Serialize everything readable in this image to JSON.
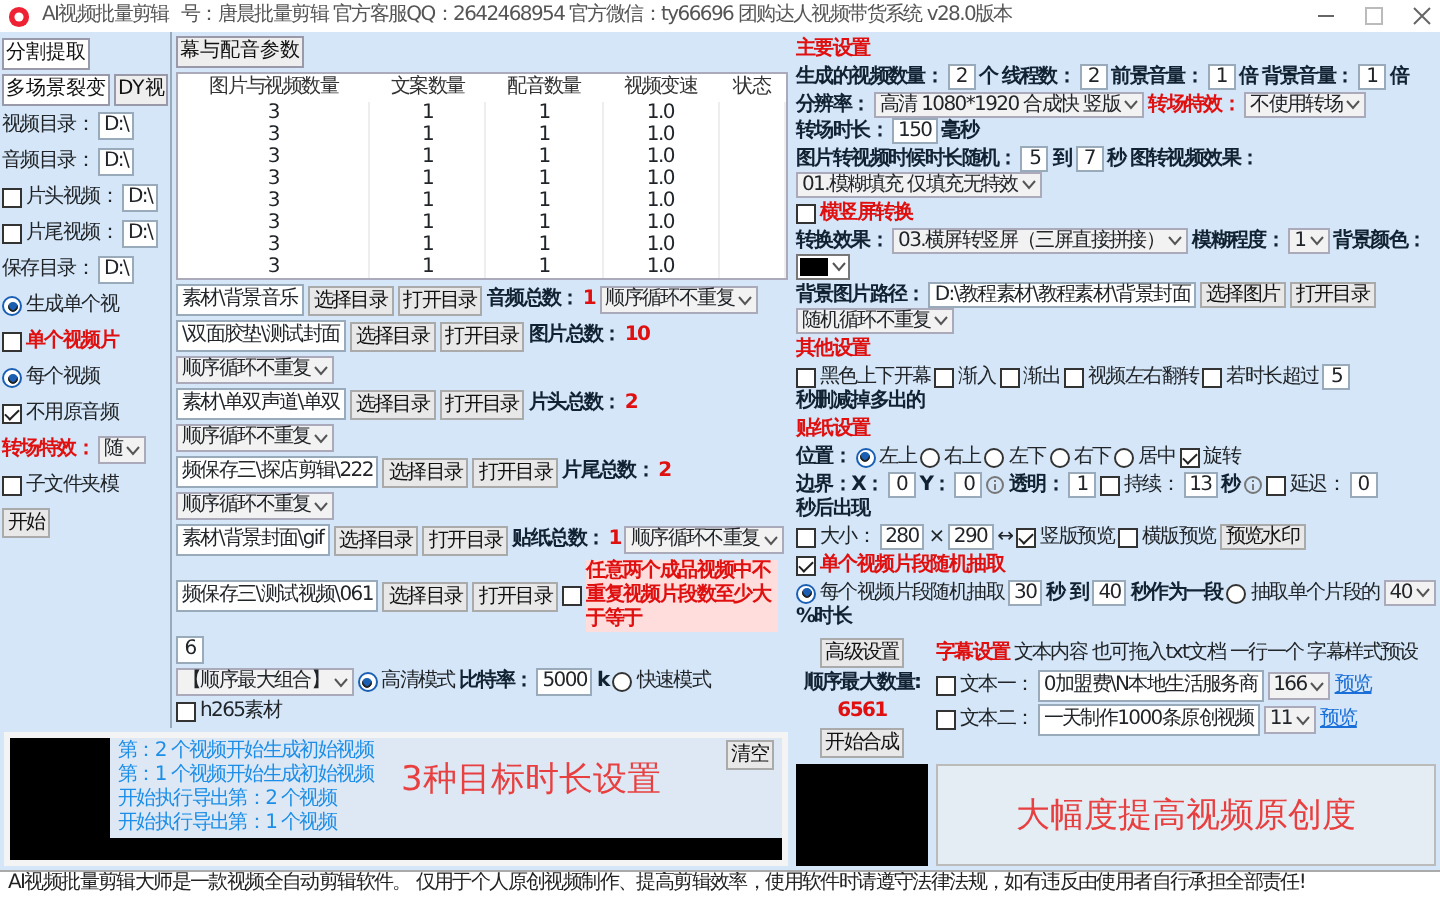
{
  "window": {
    "title": "AI视频批量剪辑",
    "subtitle": "号：唐晨批量剪辑  官方客服QQ：2642468954  官方微信：ty66696  团购达人视频带货系统  v28.0版本"
  },
  "left_panel": [
    {
      "items": [
        {
          "kind": "tab",
          "label": "分割提取",
          "selected": true
        },
        {
          "kind": "tab",
          "label": "幕与配音参数",
          "selected": false
        }
      ]
    },
    {
      "items": [
        {
          "kind": "tab",
          "label": "多场景裂变",
          "selected": true
        },
        {
          "kind": "tab",
          "label": "DY视",
          "selected": false
        }
      ]
    },
    {
      "items": [
        {
          "kind": "text",
          "text": "视频目录："
        },
        {
          "kind": "input",
          "value": "D:\\"
        }
      ]
    },
    {
      "items": [
        {
          "kind": "text",
          "text": "音频目录："
        },
        {
          "kind": "input",
          "value": "D:\\"
        }
      ]
    },
    {
      "items": [
        {
          "kind": "check",
          "label": "片头视频：",
          "checked": false
        },
        {
          "kind": "input",
          "value": "D:\\"
        }
      ]
    },
    {
      "items": [
        {
          "kind": "check",
          "label": "片尾视频：",
          "checked": false
        },
        {
          "kind": "input",
          "value": "D:\\"
        }
      ]
    },
    {
      "items": [
        {
          "kind": "text",
          "text": "保存目录："
        },
        {
          "kind": "input",
          "value": "D:\\"
        }
      ]
    },
    {
      "items": [
        {
          "kind": "radio",
          "label": "生成单个视",
          "selected": true
        }
      ]
    },
    {
      "items": [
        {
          "kind": "check",
          "label": "单个视频片",
          "checked": false,
          "alert": true
        }
      ]
    },
    {
      "items": [
        {
          "kind": "radio",
          "label": "每个视频",
          "selected": true
        }
      ]
    },
    {
      "items": [
        {
          "kind": "check",
          "label": "不用原音频",
          "checked": true
        }
      ]
    },
    {
      "items": [
        {
          "kind": "alert",
          "text": "转场特效："
        },
        {
          "kind": "select",
          "value": "随"
        }
      ]
    },
    {
      "items": [
        {
          "kind": "check",
          "label": "子文件夹模",
          "checked": false
        }
      ]
    },
    {
      "items": [
        {
          "kind": "button",
          "label": "开始"
        }
      ]
    }
  ],
  "table": {
    "columns": [
      "图片与视频数量",
      "文案数量",
      "配音数量",
      "视频变速",
      "状态"
    ],
    "rows": [
      [
        "3",
        "1",
        "1",
        "1.0"
      ],
      [
        "3",
        "1",
        "1",
        "1.0"
      ],
      [
        "3",
        "1",
        "1",
        "1.0"
      ],
      [
        "3",
        "1",
        "1",
        "1.0"
      ],
      [
        "3",
        "1",
        "1",
        "1.0"
      ],
      [
        "3",
        "1",
        "1",
        "1.0"
      ],
      [
        "3",
        "1",
        "1",
        "1.0"
      ],
      [
        "3",
        "1",
        "1",
        "1.0"
      ]
    ]
  },
  "middle_panel": [
    {
      "items": [
        {
          "kind": "path",
          "value": "素材\\背景音乐"
        },
        {
          "kind": "button",
          "label": "选择目录"
        },
        {
          "kind": "button",
          "label": "打开目录"
        },
        {
          "kind": "label",
          "text": "音频总数："
        },
        {
          "kind": "alert",
          "text": "1"
        },
        {
          "kind": "select",
          "value": "顺序循环不重复"
        }
      ]
    },
    {
      "items": [
        {
          "kind": "path",
          "value": "\\双面胶垫\\测试封面"
        },
        {
          "kind": "button",
          "label": "选择目录"
        },
        {
          "kind": "button",
          "label": "打开目录"
        },
        {
          "kind": "label",
          "text": "图片总数："
        },
        {
          "kind": "alert",
          "text": "10"
        },
        {
          "kind": "select",
          "value": "顺序循环不重复"
        }
      ]
    },
    {
      "items": [
        {
          "kind": "path",
          "value": "素材\\单双声道\\单双"
        },
        {
          "kind": "button",
          "label": "选择目录"
        },
        {
          "kind": "button",
          "label": "打开目录"
        },
        {
          "kind": "label",
          "text": "片头总数："
        },
        {
          "kind": "alert",
          "text": "2"
        },
        {
          "kind": "select",
          "value": "顺序循环不重复"
        }
      ]
    },
    {
      "items": [
        {
          "kind": "path",
          "value": "频保存三\\探店剪辑\\222"
        },
        {
          "kind": "button",
          "label": "选择目录"
        },
        {
          "kind": "button",
          "label": "打开目录"
        },
        {
          "kind": "label",
          "text": "片尾总数："
        },
        {
          "kind": "alert",
          "text": "2"
        },
        {
          "kind": "select",
          "value": "顺序循环不重复"
        }
      ]
    },
    {
      "items": [
        {
          "kind": "path",
          "value": "素材\\背景封面\\gif"
        },
        {
          "kind": "button",
          "label": "选择目录"
        },
        {
          "kind": "button",
          "label": "打开目录"
        },
        {
          "kind": "label",
          "text": "贴纸总数："
        },
        {
          "kind": "alert",
          "text": "1"
        },
        {
          "kind": "select",
          "value": "顺序循环不重复"
        }
      ]
    },
    {
      "items": [
        {
          "kind": "path",
          "value": "频保存三\\测试视频\\061"
        },
        {
          "kind": "button",
          "label": "选择目录"
        },
        {
          "kind": "button",
          "label": "打开目录"
        },
        {
          "kind": "check",
          "checked": false
        },
        {
          "kind": "note",
          "text": "任意两个成品视频中不重复视频片段数至少大于等于"
        },
        {
          "kind": "input",
          "value": "6"
        }
      ]
    },
    {
      "items": [
        {
          "kind": "select",
          "value": "【顺序最大组合】"
        },
        {
          "kind": "radio",
          "label": "高清模式",
          "selected": true
        },
        {
          "kind": "label",
          "text": "比特率："
        },
        {
          "kind": "input",
          "value": "5000"
        },
        {
          "kind": "label",
          "text": "k"
        },
        {
          "kind": "radio",
          "label": "快速模式",
          "selected": false
        },
        {
          "kind": "check",
          "label": "h265素材",
          "checked": false
        }
      ]
    }
  ],
  "right_panel": [
    {
      "items": [
        {
          "kind": "heading",
          "text": "主要设置"
        }
      ]
    },
    {
      "items": [
        {
          "kind": "label",
          "text": "生成的视频数量："
        },
        {
          "kind": "input",
          "value": "2"
        },
        {
          "kind": "label",
          "text": "个"
        },
        {
          "kind": "label",
          "text": "线程数："
        },
        {
          "kind": "input",
          "value": "2"
        },
        {
          "kind": "label",
          "text": "前景音量："
        },
        {
          "kind": "input",
          "value": "1"
        },
        {
          "kind": "label",
          "text": "倍"
        },
        {
          "kind": "label",
          "text": "背景音量："
        },
        {
          "kind": "input",
          "value": "1"
        },
        {
          "kind": "label",
          "text": "倍"
        }
      ]
    },
    {
      "items": [
        {
          "kind": "label",
          "text": "分辨率："
        },
        {
          "kind": "select",
          "value": "高清 1080*1920 合成快 竖版"
        },
        {
          "kind": "alert",
          "text": "转场特效："
        },
        {
          "kind": "select",
          "value": "不使用转场"
        },
        {
          "kind": "label",
          "text": "转场时长："
        },
        {
          "kind": "input",
          "value": "150"
        },
        {
          "kind": "label",
          "text": "毫秒"
        }
      ]
    },
    {
      "items": [
        {
          "kind": "label",
          "text": "图片转视频时候时长随机："
        },
        {
          "kind": "input",
          "value": "5"
        },
        {
          "kind": "label",
          "text": "到"
        },
        {
          "kind": "input",
          "value": "7"
        },
        {
          "kind": "label",
          "text": "秒"
        },
        {
          "kind": "label",
          "text": "图转视频效果："
        },
        {
          "kind": "select",
          "value": "01.模糊填充 仅填充无特效"
        }
      ]
    },
    {
      "items": [
        {
          "kind": "check",
          "label": "横竖屏转换",
          "checked": false,
          "alert": true
        }
      ]
    },
    {
      "items": [
        {
          "kind": "label",
          "text": "转换效果："
        },
        {
          "kind": "select",
          "value": "03.横屏转竖屏（三屏直接拼接）"
        },
        {
          "kind": "label",
          "text": "模糊程度："
        },
        {
          "kind": "select",
          "value": "1"
        },
        {
          "kind": "label",
          "text": "背景颜色："
        },
        {
          "kind": "swatch",
          "color": "#000000"
        }
      ]
    },
    {
      "items": [
        {
          "kind": "label",
          "text": "背景图片路径："
        },
        {
          "kind": "path",
          "value": "D:\\教程素材\\教程素材\\背景封面"
        },
        {
          "kind": "button",
          "label": "选择图片"
        },
        {
          "kind": "button",
          "label": "打开目录"
        },
        {
          "kind": "select",
          "value": "随机循环不重复"
        }
      ]
    },
    {
      "items": [
        {
          "kind": "heading",
          "text": "其他设置"
        }
      ]
    },
    {
      "items": [
        {
          "kind": "check",
          "label": "黑色上下开幕",
          "checked": false
        },
        {
          "kind": "check",
          "label": "渐入",
          "checked": false
        },
        {
          "kind": "check",
          "label": "渐出",
          "checked": false
        },
        {
          "kind": "check",
          "label": "视频左右翻转",
          "checked": false
        },
        {
          "kind": "check",
          "label": "若时长超过",
          "checked": false
        },
        {
          "kind": "input",
          "value": "5"
        },
        {
          "kind": "label",
          "text": "秒删减掉多出的"
        }
      ]
    },
    {
      "items": [
        {
          "kind": "heading",
          "text": "贴纸设置"
        }
      ]
    },
    {
      "items": [
        {
          "kind": "label",
          "text": "位置："
        },
        {
          "kind": "radio",
          "label": "左上",
          "selected": true
        },
        {
          "kind": "radio",
          "label": "右上",
          "selected": false
        },
        {
          "kind": "radio",
          "label": "左下",
          "selected": false
        },
        {
          "kind": "radio",
          "label": "右下",
          "selected": false
        },
        {
          "kind": "radio",
          "label": "居中",
          "selected": false
        },
        {
          "kind": "check",
          "label": "旋转",
          "checked": true
        }
      ]
    },
    {
      "items": [
        {
          "kind": "label",
          "text": "边界：X："
        },
        {
          "kind": "input",
          "value": "0"
        },
        {
          "kind": "label",
          "text": "Y："
        },
        {
          "kind": "input",
          "value": "0"
        },
        {
          "kind": "info"
        },
        {
          "kind": "label",
          "text": "透明："
        },
        {
          "kind": "input",
          "value": "1"
        },
        {
          "kind": "check",
          "label": "持续：",
          "checked": false
        },
        {
          "kind": "input",
          "value": "13"
        },
        {
          "kind": "label",
          "text": "秒"
        },
        {
          "kind": "info"
        },
        {
          "kind": "check",
          "label": "延迟：",
          "checked": false
        },
        {
          "kind": "input",
          "value": "0"
        },
        {
          "kind": "label",
          "text": "秒后出现"
        }
      ]
    },
    {
      "items": [
        {
          "kind": "check",
          "label": "大小：",
          "checked": false
        },
        {
          "kind": "input",
          "value": "280"
        },
        {
          "kind": "text",
          "text": "×"
        },
        {
          "kind": "input",
          "value": "290"
        },
        {
          "kind": "text",
          "text": "↔"
        },
        {
          "kind": "check",
          "label": "竖版预览",
          "checked": true
        },
        {
          "kind": "check",
          "label": "横版预览",
          "checked": false
        },
        {
          "kind": "button",
          "label": "预览水印"
        }
      ]
    },
    {
      "items": [
        {
          "kind": "check",
          "label": "单个视频片段随机抽取",
          "checked": true,
          "alert": true
        }
      ]
    },
    {
      "items": [
        {
          "kind": "radio",
          "label": "每个视频片段随机抽取",
          "selected": true
        },
        {
          "kind": "input",
          "value": "30"
        },
        {
          "kind": "label",
          "text": "秒 到"
        },
        {
          "kind": "input",
          "value": "40"
        },
        {
          "kind": "label",
          "text": "秒作为一段"
        },
        {
          "kind": "radio",
          "label": "抽取单个片段的",
          "selected": false
        },
        {
          "kind": "select",
          "value": "40"
        },
        {
          "kind": "label",
          "text": "%时长"
        }
      ]
    }
  ],
  "log": {
    "lines": [
      "第：2 个视频开始生成初始视频",
      "第：1 个视频开始生成初始视频",
      "开始执行导出第：2 个视频",
      "开始执行导出第：1 个视频"
    ],
    "clear_button": "清空"
  },
  "compose": {
    "advanced_button": "高级设置",
    "max_label": "顺序最大数量:",
    "max_value": "6561",
    "start_button": "开始合成"
  },
  "subtitles": {
    "heading": "字幕设置",
    "content_header": "文本内容 也可拖入txt文档 一行一个",
    "style_header": "字幕样式预设",
    "rows": [
      {
        "label": "文本一：",
        "checked": false,
        "value": "0加盟费\\N本地生活服务商",
        "style": "166",
        "link": "预览"
      },
      {
        "label": "文本二：",
        "checked": false,
        "value": "一天制作1000条原创视频",
        "style": "11",
        "link": "预览"
      }
    ]
  },
  "captions": [
    "3种目标时长设置",
    "大幅度提高视频原创度"
  ],
  "status_bar": "AI视频批量剪辑大师是一款视频全自动剪辑软件。 仅用于个人原创视频制作、提高剪辑效率，使用软件时请遵守法律法规，如有违反由使用者自行承担全部责任!"
}
